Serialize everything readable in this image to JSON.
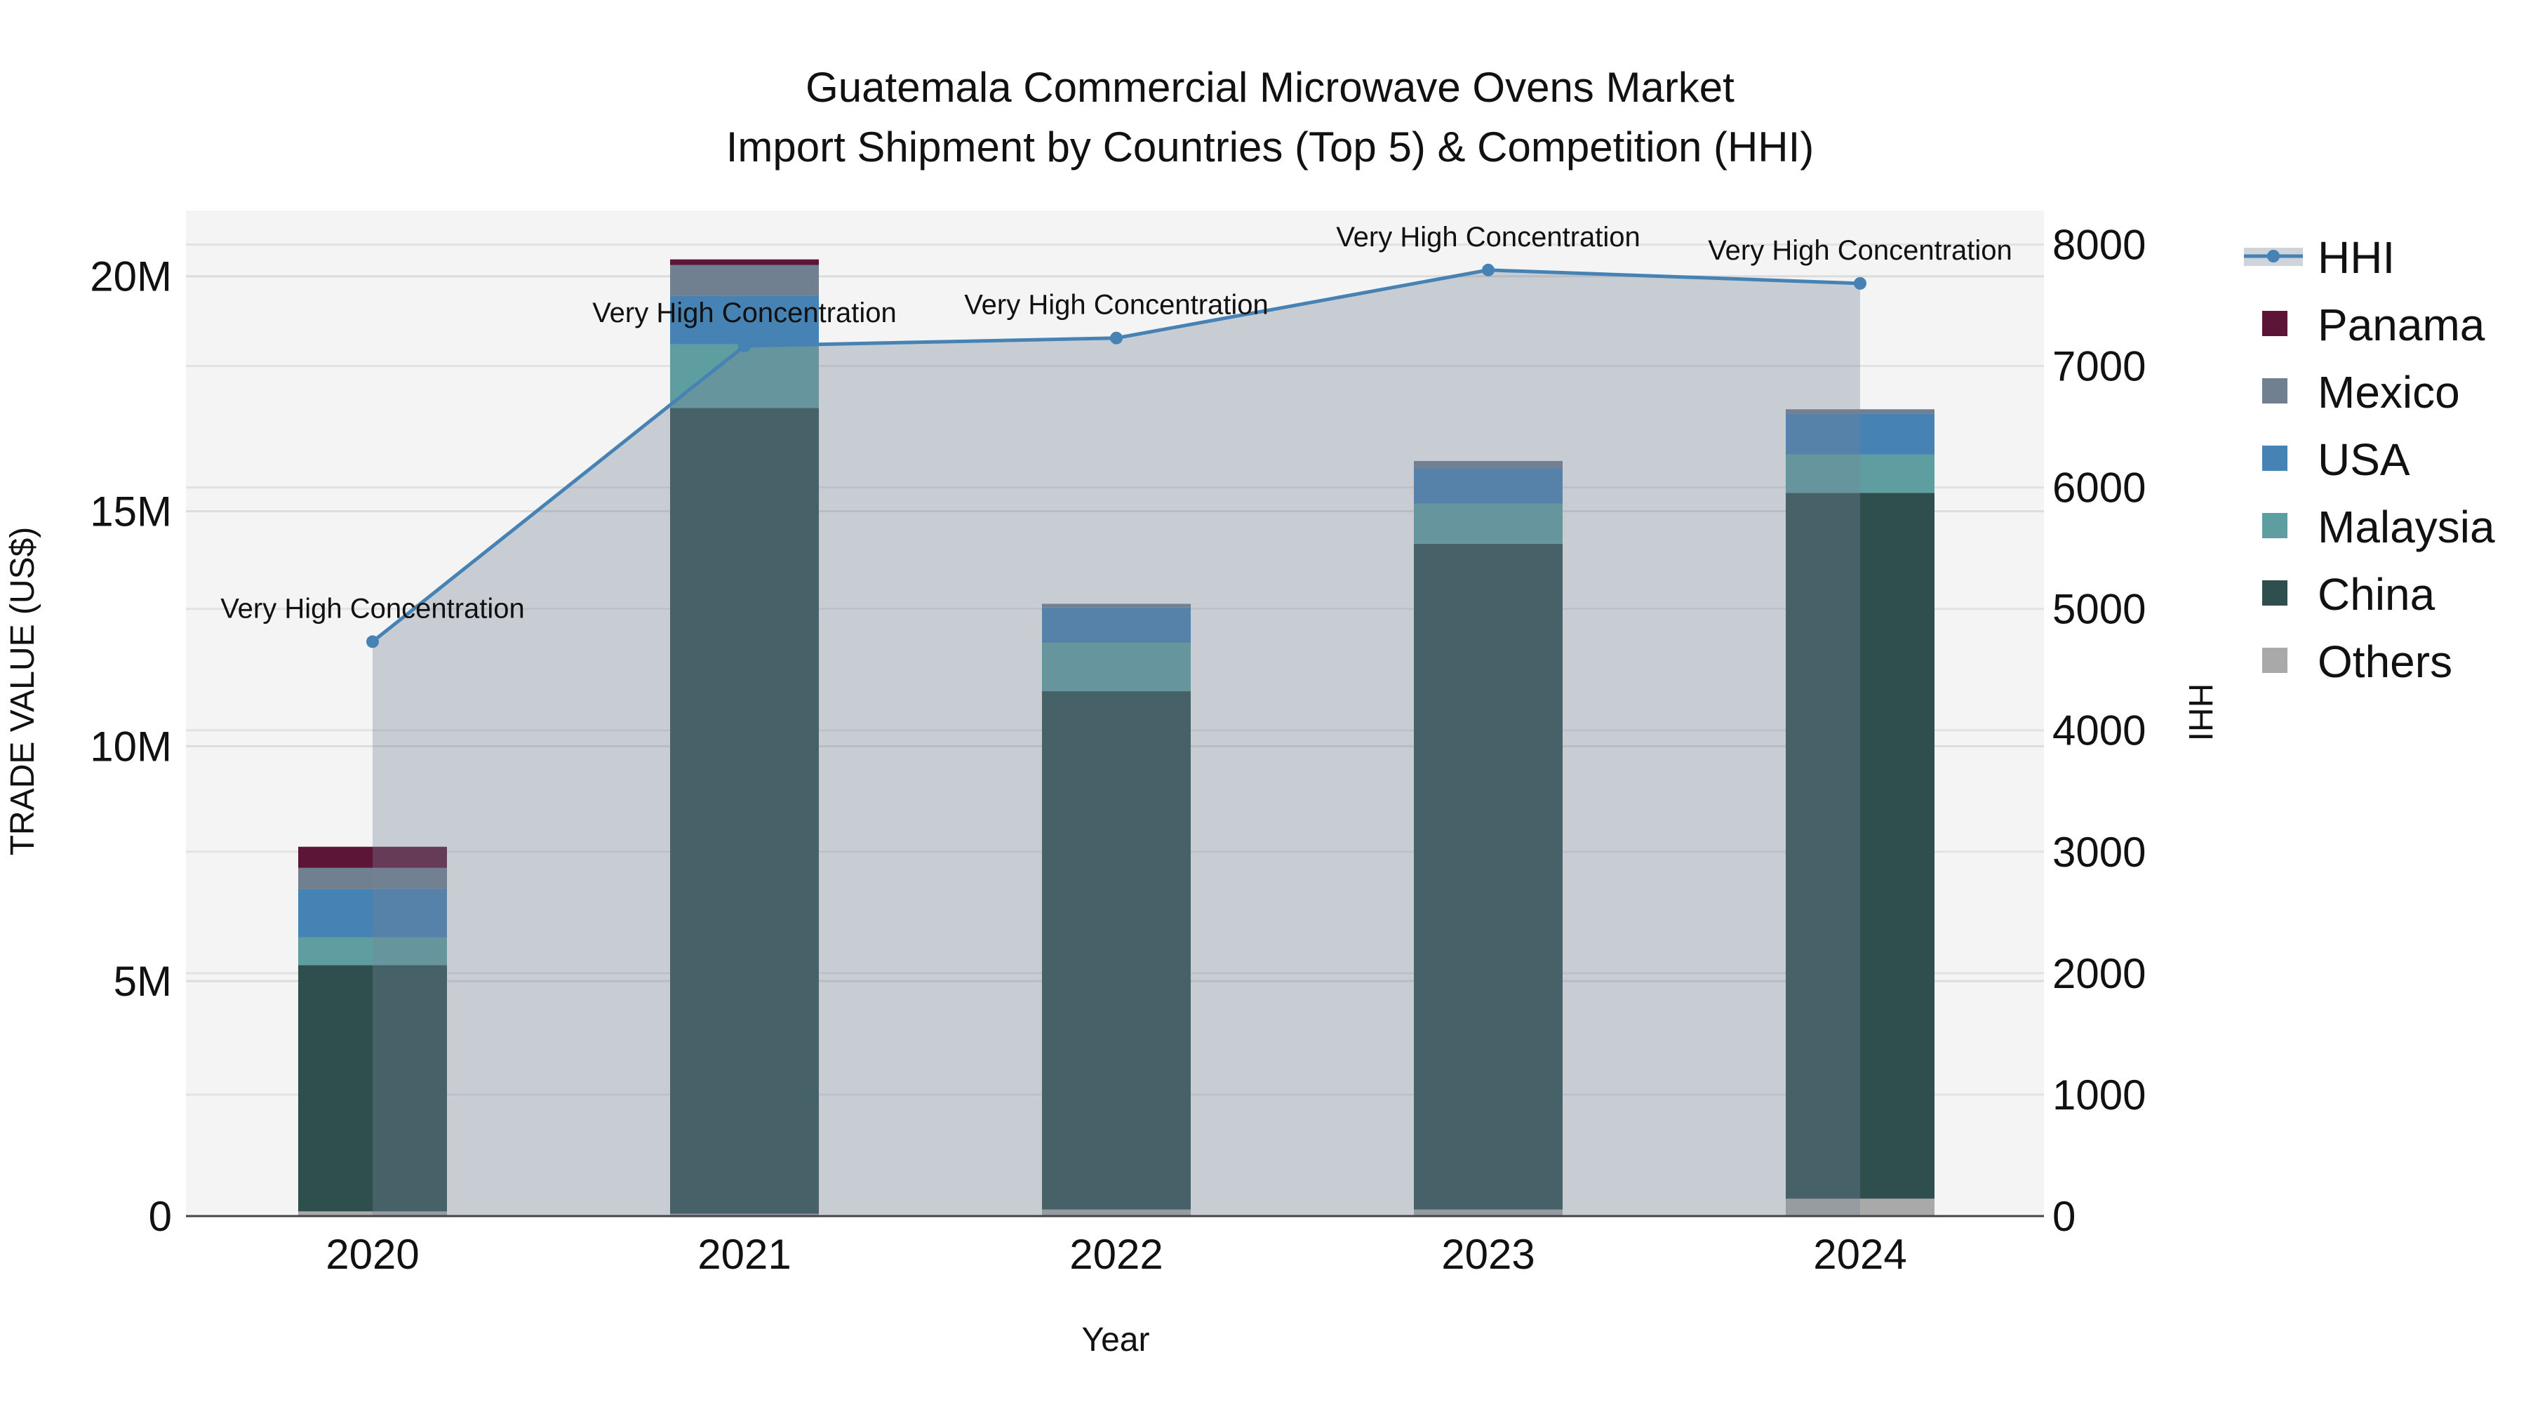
{
  "chart_data": {
    "type": "bar",
    "title_line1": "Guatemala Commercial Microwave Ovens Market",
    "title_line2": "Import Shipment by Countries (Top 5) & Competition (HHI)",
    "xlabel": "Year",
    "ylabel": "TRADE VALUE (US$)",
    "y2label": "HHI",
    "categories": [
      "2020",
      "2021",
      "2022",
      "2023",
      "2024"
    ],
    "ylim": [
      0,
      21.4
    ],
    "y_unit": "M",
    "y_ticks": [
      0,
      5,
      10,
      15,
      20
    ],
    "y_tick_labels": [
      "0",
      "5M",
      "10M",
      "15M",
      "20M"
    ],
    "y2lim": [
      0,
      8280
    ],
    "y2_ticks": [
      0,
      1000,
      2000,
      3000,
      4000,
      5000,
      6000,
      7000,
      8000
    ],
    "y2_tick_labels": [
      "0",
      "1000",
      "2000",
      "3000",
      "4000",
      "5000",
      "6000",
      "7000",
      "8000"
    ],
    "grid": true,
    "legend_position": "right",
    "series": [
      {
        "name": "Others",
        "color": "#a9a9a9",
        "values": [
          0.1,
          0.05,
          0.14,
          0.14,
          0.37
        ]
      },
      {
        "name": "China",
        "color": "#2f4f4f",
        "values": [
          5.24,
          17.15,
          11.03,
          14.17,
          15.02
        ]
      },
      {
        "name": "Malaysia",
        "color": "#5f9ea0",
        "values": [
          0.59,
          1.35,
          1.03,
          0.85,
          0.82
        ]
      },
      {
        "name": "USA",
        "color": "#4682b4",
        "values": [
          1.03,
          1.04,
          0.75,
          0.76,
          0.86
        ]
      },
      {
        "name": "Mexico",
        "color": "#708090",
        "values": [
          0.45,
          0.65,
          0.08,
          0.15,
          0.1
        ]
      },
      {
        "name": "Panama",
        "color": "#5c1536",
        "values": [
          0.45,
          0.12,
          0,
          0,
          0
        ]
      }
    ],
    "hhi": {
      "name": "HHI",
      "color": "#4682b4",
      "values": [
        4730,
        7165,
        7230,
        7790,
        7680
      ],
      "annotations": [
        "Very High Concentration",
        "Very High Concentration",
        "Very High Concentration",
        "Very High Concentration",
        "Very High Concentration"
      ]
    },
    "legend_order": [
      "HHI",
      "Panama",
      "Mexico",
      "USA",
      "Malaysia",
      "China",
      "Others"
    ]
  }
}
